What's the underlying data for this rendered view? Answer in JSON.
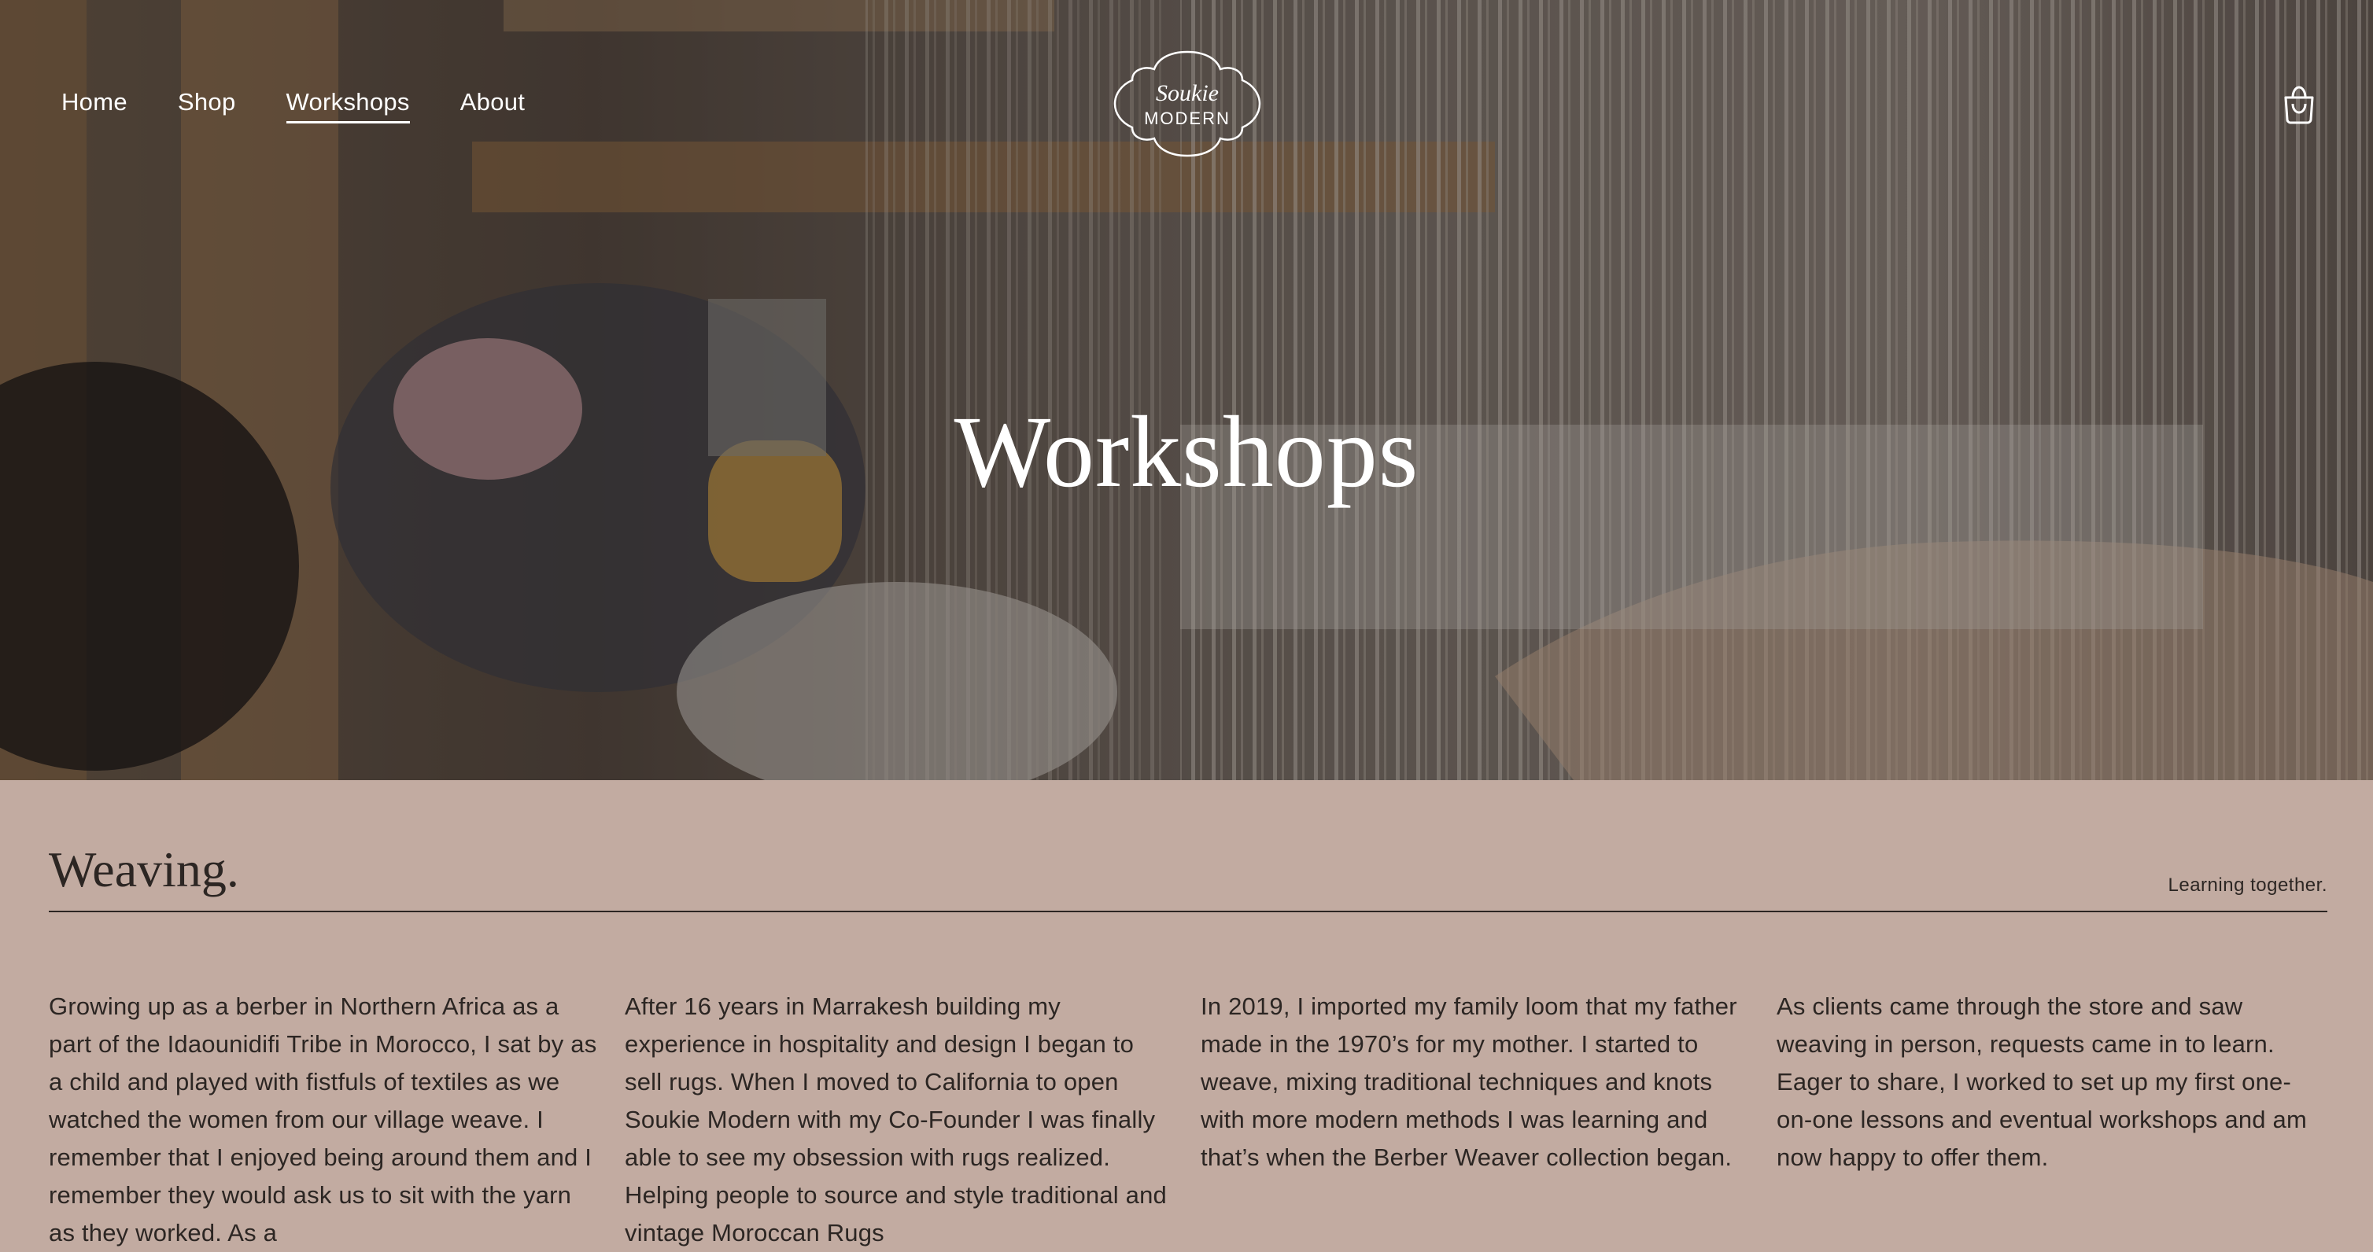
{
  "nav": {
    "items": [
      "Home",
      "Shop",
      "Workshops",
      "About"
    ],
    "active": "Workshops"
  },
  "logo": {
    "line1": "Soukie",
    "line2": "MODERN"
  },
  "icons": {
    "cart": "shopping-bag-icon"
  },
  "hero": {
    "title": "Workshops"
  },
  "section": {
    "title": "Weaving.",
    "tagline": "Learning together.",
    "columns": [
      "Growing up as a berber in Northern Africa as a part of the Idaounidifi Tribe in Morocco, I sat by as a child and played with fistfuls of textiles as we watched the women from our village weave. I remember that I enjoyed being around them and I remember they would ask us to sit with the yarn as they worked. As a",
      "After 16 years in Marrakesh building my experience in hospitality and design I began to sell rugs. When I moved to California to open Soukie Modern with my Co-Founder I was finally able to see my obsession with rugs realized. Helping people to source and style traditional and vintage Moroccan Rugs",
      "In 2019, I imported my family loom that my father made in the 1970’s for my mother. I started to weave, mixing traditional techniques and knots with more modern methods I was learning and that’s when the Berber Weaver collection began.",
      "As clients came through the store and saw weaving in person, requests came in to learn. Eager to share, I worked to set up my first one-on-one lessons and eventual workshops and am now happy to offer them."
    ]
  },
  "colors": {
    "content_bg": "#c2aba1",
    "text": "#2c2623",
    "hero_text": "#ffffff"
  }
}
